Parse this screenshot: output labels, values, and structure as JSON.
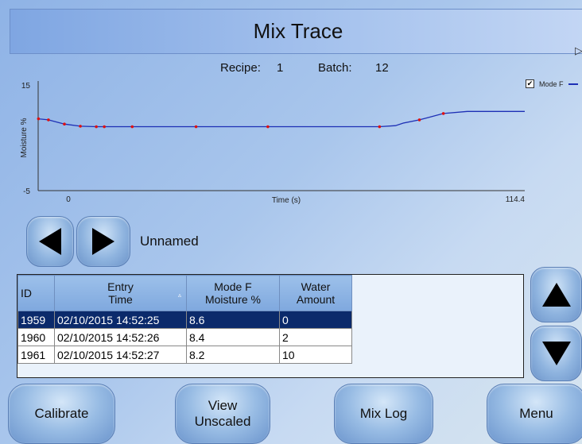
{
  "title": "Mix Trace",
  "info": {
    "recipe_label": "Recipe:",
    "recipe_value": "1",
    "batch_label": "Batch:",
    "batch_value": "12"
  },
  "legend": {
    "checkbox_checked": true,
    "checkbox_glyph": "✔",
    "label": "Mode F"
  },
  "chart_data": {
    "type": "line",
    "ylabel": "Moisture %",
    "xlabel": "Time (s)",
    "ylim": [
      -5,
      15
    ],
    "xlim": [
      0,
      114.4
    ],
    "y_ticks": [
      "15",
      "-5"
    ],
    "x_ticks": [
      "0",
      "114.4"
    ],
    "series": [
      {
        "name": "Mode F",
        "color": "#1d2fb5",
        "marker_color": "#e01010",
        "x": [
          -7.5,
          -5,
          -1,
          3,
          7,
          9,
          16,
          32,
          50,
          78,
          82,
          84,
          88,
          90,
          94,
          100,
          114.4
        ],
        "y": [
          8.6,
          8.4,
          7.6,
          7.2,
          7.1,
          7.1,
          7.1,
          7.1,
          7.1,
          7.1,
          7.3,
          7.8,
          8.4,
          8.8,
          9.6,
          10.0,
          10.0
        ]
      }
    ],
    "markers_x": [
      -7.5,
      -5,
      -1,
      3,
      7,
      9,
      16,
      32,
      50,
      78,
      88,
      94
    ]
  },
  "nav": {
    "prev_icon": "triangle-left-icon",
    "next_icon": "triangle-right-icon",
    "record_name": "Unnamed"
  },
  "table": {
    "columns": [
      {
        "line1": "ID",
        "line2": ""
      },
      {
        "line1": "Entry",
        "line2": "Time"
      },
      {
        "line1": "Mode F",
        "line2": "Moisture %"
      },
      {
        "line1": "Water",
        "line2": "Amount"
      }
    ],
    "sort_glyph": "▵",
    "rows": [
      {
        "id": "1959",
        "time": "02/10/2015 14:52:25",
        "moisture": "8.6",
        "water": "0",
        "selected": true
      },
      {
        "id": "1960",
        "time": "02/10/2015 14:52:26",
        "moisture": "8.4",
        "water": "2",
        "selected": false
      },
      {
        "id": "1961",
        "time": "02/10/2015 14:52:27",
        "moisture": "8.2",
        "water": "10",
        "selected": false
      }
    ]
  },
  "scroll": {
    "up_icon": "triangle-up-icon",
    "down_icon": "triangle-down-icon"
  },
  "buttons": {
    "calibrate": "Calibrate",
    "view_line1": "View",
    "view_line2": "Unscaled",
    "mix_log": "Mix Log",
    "menu": "Menu"
  },
  "colors": {
    "selected_row": "#0b2a6b",
    "trace": "#1d2fb5",
    "marker": "#e01010"
  }
}
